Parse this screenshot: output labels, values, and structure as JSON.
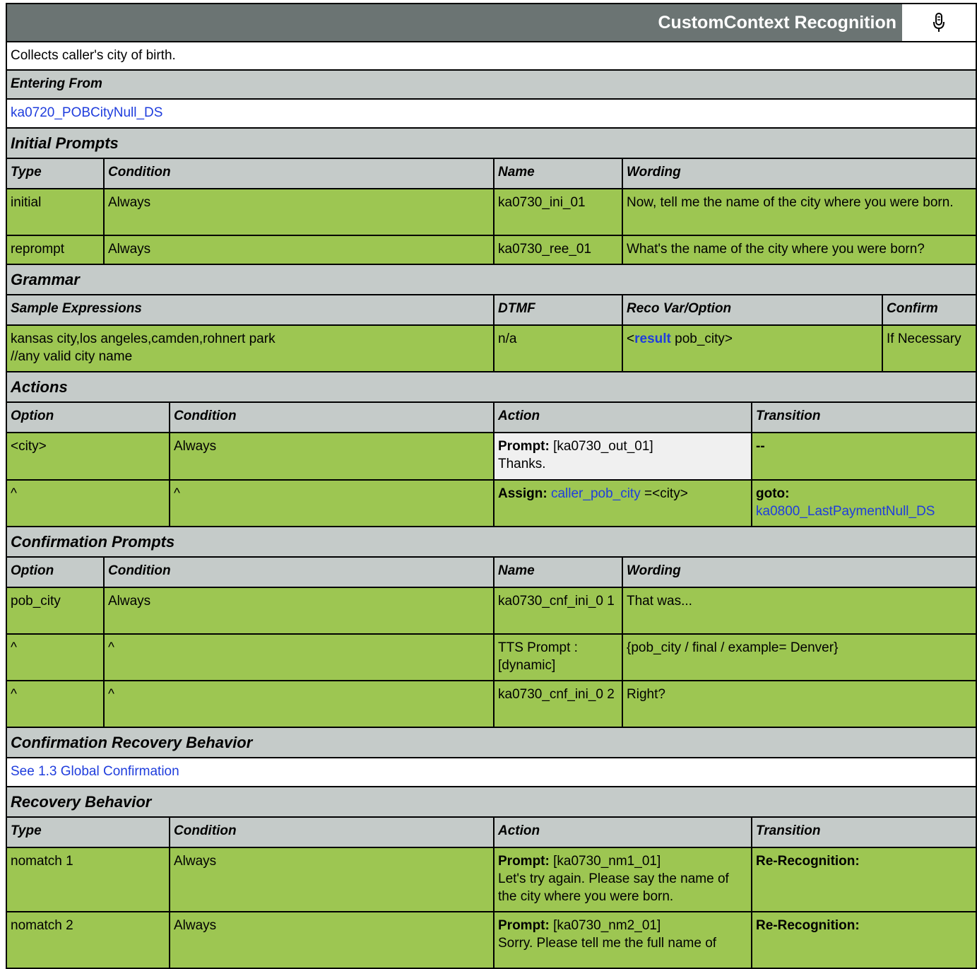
{
  "header": {
    "title": "CustomContext Recognition",
    "mic_icon": "microphone-icon"
  },
  "description": "Collects caller's city of birth.",
  "entering_from": {
    "label": "Entering From",
    "link": "ka0720_POBCityNull_DS"
  },
  "initial_prompts": {
    "label": "Initial Prompts",
    "columns": [
      "Type",
      "Condition",
      "Name",
      "Wording"
    ],
    "rows": [
      {
        "type": "initial",
        "condition": "Always",
        "name": "ka0730_ini_01",
        "wording": "Now, tell me the name of the city where you were born."
      },
      {
        "type": "reprompt",
        "condition": "Always",
        "name": "ka0730_ree_01",
        "wording": "What's the name of the city where you were born?"
      }
    ]
  },
  "grammar": {
    "label": "Grammar",
    "columns": [
      "Sample Expressions",
      "DTMF",
      "Reco Var/Option",
      "Confirm"
    ],
    "row": {
      "expr_line1": "kansas city,los angeles,camden,rohnert park",
      "expr_line2": "//any valid city name",
      "dtmf": "n/a",
      "reco_pre": "<",
      "reco_kw": "result",
      "reco_post": " pob_city>",
      "confirm": "If Necessary"
    }
  },
  "actions": {
    "label": "Actions",
    "columns": [
      "Option",
      "Condition",
      "Action",
      "Transition"
    ],
    "rows": [
      {
        "option": "<city>",
        "condition": "Always",
        "action_label": "Prompt:",
        "action_text": " [ka0730_out_01]",
        "action_line2": "Thanks.",
        "transition": "--"
      },
      {
        "option": "^",
        "condition": "^",
        "action_label": "Assign:",
        "action_link": "caller_pob_city",
        "action_text": " =<city>",
        "transition_label": "goto:",
        "transition_link": "ka0800_LastPaymentNull_DS"
      }
    ]
  },
  "confirmation_prompts": {
    "label": "Confirmation Prompts",
    "columns": [
      "Option",
      "Condition",
      "Name",
      "Wording"
    ],
    "rows": [
      {
        "option": "pob_city",
        "condition": "Always",
        "name": "ka0730_cnf_ini_0 1",
        "wording": "That was..."
      },
      {
        "option": "^",
        "condition": "^",
        "name": "TTS Prompt : [dynamic]",
        "wording": "{pob_city / final / example= Denver}"
      },
      {
        "option": "^",
        "condition": "^",
        "name": "ka0730_cnf_ini_0 2",
        "wording": "Right?"
      }
    ]
  },
  "confirmation_recovery": {
    "label": "Confirmation Recovery Behavior",
    "link": "See 1.3 Global Confirmation"
  },
  "recovery": {
    "label": "Recovery Behavior",
    "columns": [
      "Type",
      "Condition",
      "Action",
      "Transition"
    ],
    "rows": [
      {
        "type": "nomatch 1",
        "condition": "Always",
        "action_label": "Prompt:",
        "action_text": " [ka0730_nm1_01]",
        "action_line2": "Let's try again. Please say the name of the city where you were born.",
        "transition": "Re-Recognition:"
      },
      {
        "type": "nomatch 2",
        "condition": "Always",
        "action_label": "Prompt:",
        "action_text": " [ka0730_nm2_01]",
        "action_line2": "Sorry.  Please tell me the full name of",
        "transition": "Re-Recognition:"
      }
    ]
  }
}
